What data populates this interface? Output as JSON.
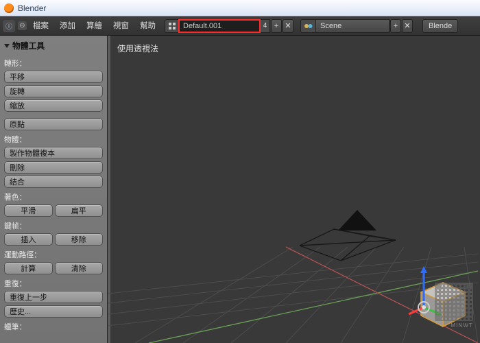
{
  "window": {
    "title": "Blender"
  },
  "topmenu": {
    "items": [
      "檔案",
      "添加",
      "算繪",
      "視窗",
      "幫助"
    ],
    "layout": {
      "value": "Default.001",
      "user_count": "4"
    },
    "scene": {
      "value": "Scene"
    },
    "engine": {
      "value": "Blende"
    }
  },
  "panel": {
    "title": "物體工具",
    "sections": {
      "transform": {
        "label": "轉形：",
        "translate": "平移",
        "rotate": "旋轉",
        "scale": "縮放"
      },
      "origin": {
        "btn": "原點"
      },
      "object": {
        "label": "物體：",
        "duplicate": "製作物體複本",
        "delete": "刪除",
        "join": "結合"
      },
      "shading": {
        "label": "著色：",
        "smooth": "平滑",
        "flat": "扁平"
      },
      "keyframes": {
        "label": "鍵帧：",
        "insert": "插入",
        "remove": "移除"
      },
      "motion": {
        "label": "運動路徑：",
        "calculate": "計算",
        "clear": "清除"
      },
      "repeat": {
        "label": "重復：",
        "last": "重復上一步",
        "history": "歷史..."
      },
      "pencil": {
        "label": "蠟筆："
      }
    }
  },
  "viewport": {
    "persp_label": "使用透視法"
  },
  "watermark": {
    "text": "MINWT"
  }
}
